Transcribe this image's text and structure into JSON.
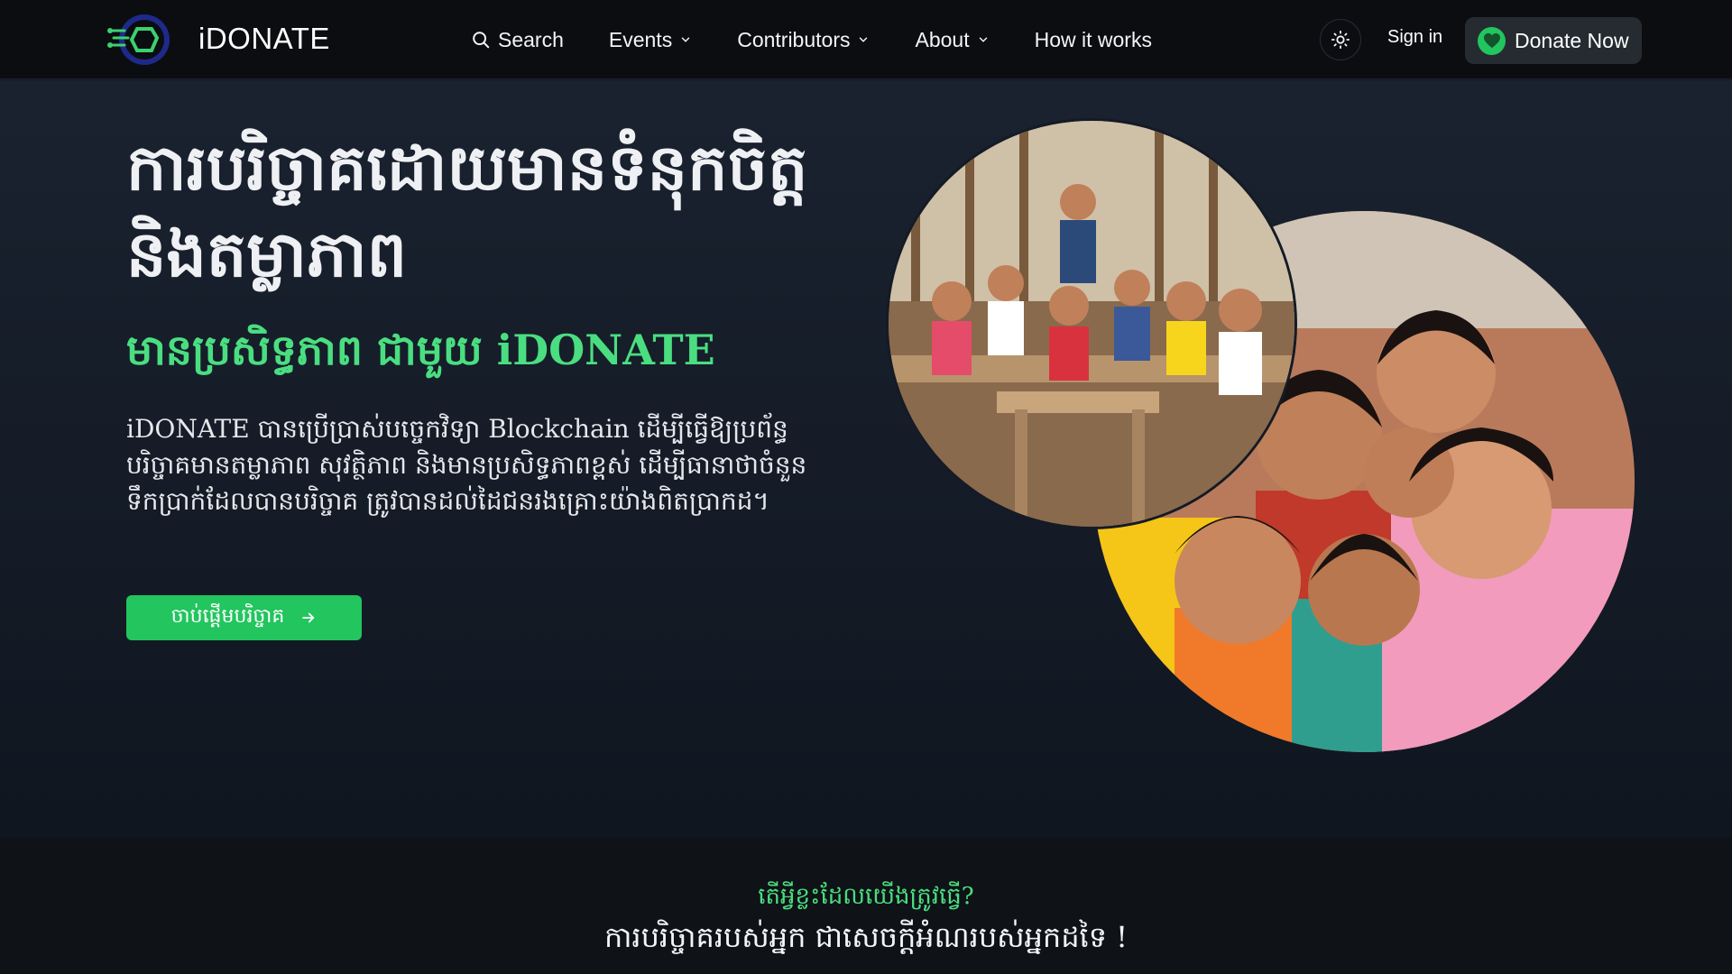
{
  "header": {
    "brand": "iDONATE",
    "nav": [
      {
        "label": "Search",
        "icon": "search-icon"
      },
      {
        "label": "Events",
        "icon": "chevron-down-icon"
      },
      {
        "label": "Contributors",
        "icon": "chevron-down-icon"
      },
      {
        "label": "About",
        "icon": "chevron-down-icon"
      },
      {
        "label": "How it works"
      }
    ],
    "theme_icon": "sun-icon",
    "sign_in": "Sign in",
    "donate": "Donate Now",
    "donate_icon": "heart-icon"
  },
  "hero": {
    "title": "ការបរិច្ចាគដោយមានទំនុកចិត្ត និងតម្លាភាព",
    "subtitle": "មានប្រសិទ្ធភាព ជាមួយ iDONATE",
    "description": "iDONATE បានប្រើប្រាស់បច្ចេកវិទ្យា Blockchain ដើម្បីធ្វើឱ្យប្រព័ន្ធបរិច្ចាគមានតម្លាភាព សុវត្ថិភាព និងមានប្រសិទ្ធភាពខ្ពស់ ដើម្បីធានាថាចំនួនទឹកប្រាក់ដែលបានបរិច្ចាគ ត្រូវបានដល់ដៃជនរងគ្រោះយ៉ាងពិតប្រាកដ។",
    "cta": "ចាប់ផ្តើមបរិច្ចាគ",
    "cta_icon": "arrow-right-icon"
  },
  "bottom": {
    "question": "តើអ្វីខ្លះដែលយើងត្រូវធ្វើ?",
    "answer": "ការបរិច្ចាគរបស់អ្នក ជាសេចក្តីអំណរបស់អ្នកដទៃ !"
  },
  "colors": {
    "accent": "#22c55e",
    "accent_text": "#4ade80",
    "header_bg": "#0b0d10",
    "hero_bg": "#1a2230"
  }
}
